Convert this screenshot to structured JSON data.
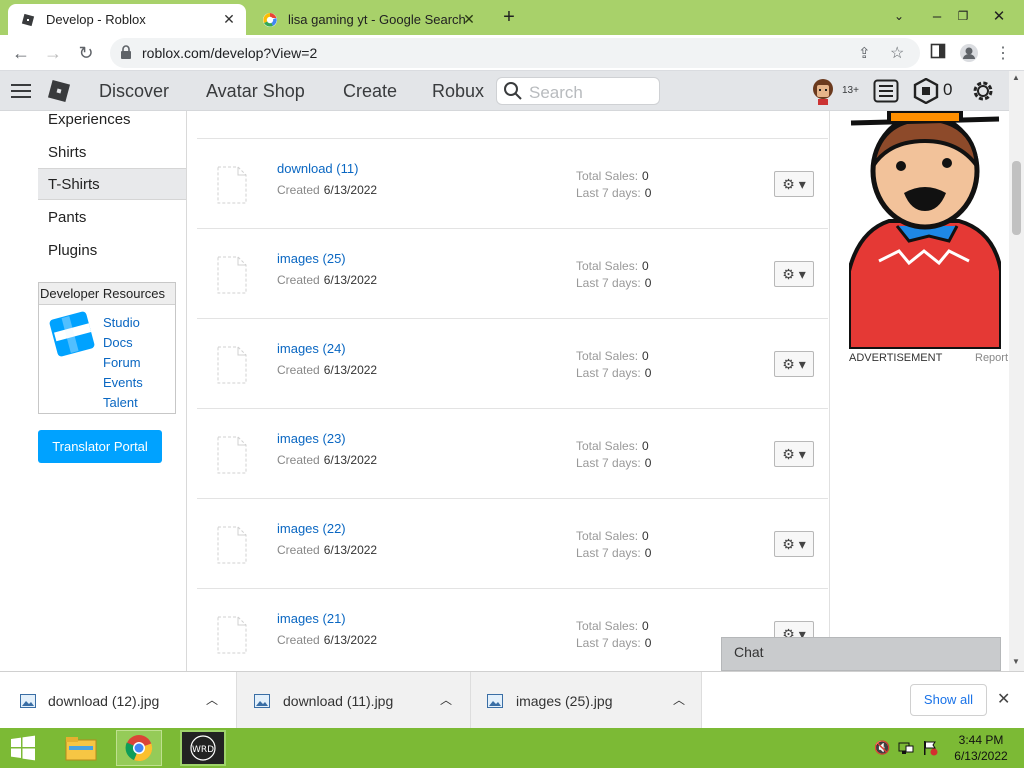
{
  "browser": {
    "tabs": [
      {
        "title": "Develop - Roblox",
        "icon": "roblox-favicon",
        "active": true
      },
      {
        "title": "lisa gaming yt - Google Search",
        "icon": "google-favicon",
        "active": false
      }
    ],
    "new_tab_symbol": "+",
    "url": "roblox.com/develop?View=2"
  },
  "roblox_header": {
    "nav": [
      "Discover",
      "Avatar Shop",
      "Create",
      "Robux"
    ],
    "search_placeholder": "Search",
    "age_badge": "13+",
    "robux_count": "0"
  },
  "sidebar": {
    "items": [
      {
        "label": "Experiences",
        "active": false
      },
      {
        "label": "Shirts",
        "active": false
      },
      {
        "label": "T-Shirts",
        "active": true
      },
      {
        "label": "Pants",
        "active": false
      },
      {
        "label": "Plugins",
        "active": false
      }
    ],
    "dev_resources": {
      "title": "Developer Resources",
      "links": [
        "Studio",
        "Docs",
        "Forum",
        "Events",
        "Talent"
      ]
    },
    "translator_button": "Translator Portal"
  },
  "items": [
    {
      "name": "download (11)",
      "created_label": "Created",
      "created": "6/13/2022",
      "total_sales_label": "Total Sales:",
      "total_sales": "0",
      "last7_label": "Last 7 days:",
      "last7": "0"
    },
    {
      "name": "images (25)",
      "created_label": "Created",
      "created": "6/13/2022",
      "total_sales_label": "Total Sales:",
      "total_sales": "0",
      "last7_label": "Last 7 days:",
      "last7": "0"
    },
    {
      "name": "images (24)",
      "created_label": "Created",
      "created": "6/13/2022",
      "total_sales_label": "Total Sales:",
      "total_sales": "0",
      "last7_label": "Last 7 days:",
      "last7": "0"
    },
    {
      "name": "images (23)",
      "created_label": "Created",
      "created": "6/13/2022",
      "total_sales_label": "Total Sales:",
      "total_sales": "0",
      "last7_label": "Last 7 days:",
      "last7": "0"
    },
    {
      "name": "images (22)",
      "created_label": "Created",
      "created": "6/13/2022",
      "total_sales_label": "Total Sales:",
      "total_sales": "0",
      "last7_label": "Last 7 days:",
      "last7": "0"
    },
    {
      "name": "images (21)",
      "created_label": "Created",
      "created": "6/13/2022",
      "total_sales_label": "Total Sales:",
      "total_sales": "0",
      "last7_label": "Last 7 days:",
      "last7": "0"
    }
  ],
  "ad": {
    "label": "ADVERTISEMENT",
    "report": "Report"
  },
  "chat_label": "Chat",
  "downloads": {
    "files": [
      "download (12).jpg",
      "download (11).jpg",
      "images (25).jpg"
    ],
    "show_all": "Show all"
  },
  "taskbar": {
    "time": "3:44 PM",
    "date": "6/13/2022",
    "app_icon_text": "WRD"
  },
  "colors": {
    "taskbar": "#7cba35",
    "tabstrip": "#a8d16a",
    "link": "#0a67c2",
    "translator": "#00a2ff"
  }
}
